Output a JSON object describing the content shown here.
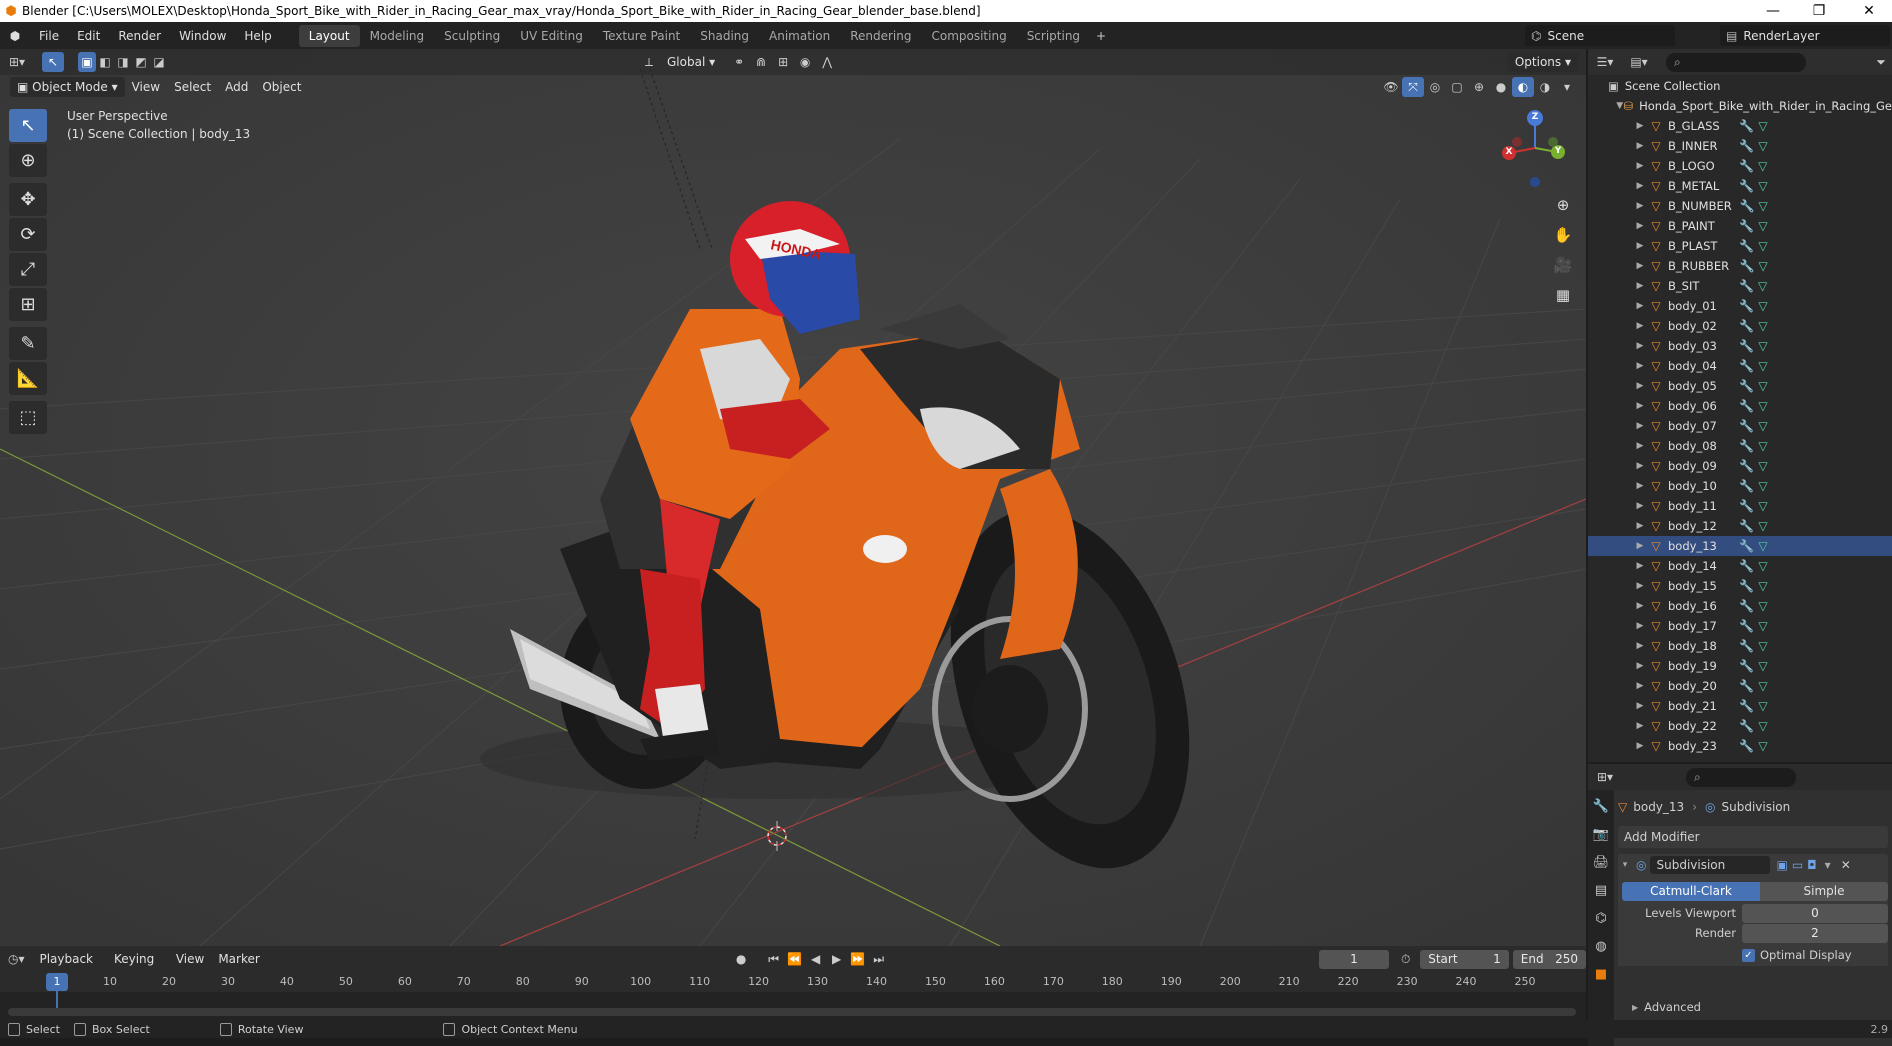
{
  "window": {
    "title": "Blender [C:\\Users\\MOLEX\\Desktop\\Honda_Sport_Bike_with_Rider_in_Racing_Gear_max_vray/Honda_Sport_Bike_with_Rider_in_Racing_Gear_blender_base.blend]"
  },
  "menu": [
    "File",
    "Edit",
    "Render",
    "Window",
    "Help"
  ],
  "workspaces": [
    "Layout",
    "Modeling",
    "Sculpting",
    "UV Editing",
    "Texture Paint",
    "Shading",
    "Animation",
    "Rendering",
    "Compositing",
    "Scripting"
  ],
  "scene": {
    "name": "Scene",
    "layer": "RenderLayer"
  },
  "viewport": {
    "mode": "Object Mode",
    "menus": [
      "View",
      "Select",
      "Add",
      "Object"
    ],
    "transform_orientation": "Global",
    "options_label": "Options",
    "perspective": "User Perspective",
    "collection_info": "(1) Scene Collection | body_13",
    "gizmo_axis": {
      "x": "X",
      "y": "Y",
      "z": "Z"
    }
  },
  "outliner": {
    "root": "Scene Collection",
    "collection": "Honda_Sport_Bike_with_Rider_in_Racing_Ge",
    "objects": [
      "B_GLASS",
      "B_INNER",
      "B_LOGO",
      "B_METAL",
      "B_NUMBER",
      "B_PAINT",
      "B_PLAST",
      "B_RUBBER",
      "B_SIT",
      "body_01",
      "body_02",
      "body_03",
      "body_04",
      "body_05",
      "body_06",
      "body_07",
      "body_08",
      "body_09",
      "body_10",
      "body_11",
      "body_12",
      "body_13",
      "body_14",
      "body_15",
      "body_16",
      "body_17",
      "body_18",
      "body_19",
      "body_20",
      "body_21",
      "body_22",
      "body_23"
    ],
    "selected": "body_13"
  },
  "properties": {
    "object": "body_13",
    "modifier_context": "Subdivision",
    "add_modifier": "Add Modifier",
    "modifier_name": "Subdivision",
    "types": [
      "Catmull-Clark",
      "Simple"
    ],
    "active_type": "Catmull-Clark",
    "levels_viewport_label": "Levels Viewport",
    "levels_viewport": "0",
    "render_label": "Render",
    "render_levels": "2",
    "optimal_display": "Optimal Display",
    "advanced": "Advanced"
  },
  "timeline": {
    "menus": [
      "Playback",
      "Keying",
      "View",
      "Marker"
    ],
    "current_frame": "1",
    "start_label": "Start",
    "start": "1",
    "end_label": "End",
    "end": "250",
    "ticks": [
      "1",
      "10",
      "20",
      "30",
      "40",
      "50",
      "60",
      "70",
      "80",
      "90",
      "100",
      "110",
      "120",
      "130",
      "140",
      "150",
      "160",
      "170",
      "180",
      "190",
      "200",
      "210",
      "220",
      "230",
      "240",
      "250"
    ]
  },
  "statusbar": {
    "select": "Select",
    "box_select": "Box Select",
    "rotate_view": "Rotate View",
    "context_menu": "Object Context Menu",
    "version": "2.9"
  },
  "colors": {
    "accent": "#4772b3",
    "bike_orange": "#e0661a",
    "helmet_red": "#d8202a",
    "helmet_blue": "#2a4aa8",
    "viewport_bg": "#3d3d3d"
  }
}
